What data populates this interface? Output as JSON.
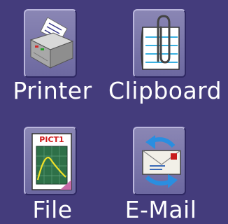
{
  "tiles": [
    {
      "label": "Printer",
      "icon": "printer-icon"
    },
    {
      "label": "Clipboard",
      "icon": "clipboard-icon"
    },
    {
      "label": "File",
      "icon": "file-icon",
      "icon_text": "PICT1"
    },
    {
      "label": "E-Mail",
      "icon": "email-icon"
    }
  ],
  "colors": {
    "background": "#443c7c",
    "tile_face": "#7874ab",
    "label": "#ffffff"
  }
}
